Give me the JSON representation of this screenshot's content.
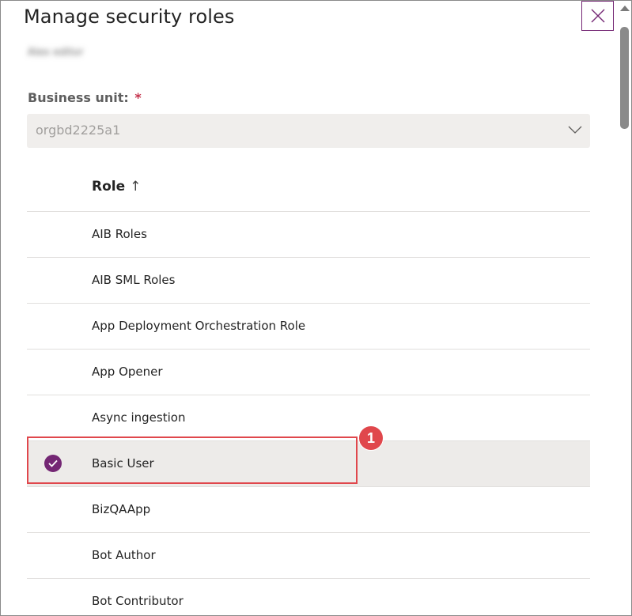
{
  "dialog": {
    "title": "Manage security roles",
    "user_name": "Alex editor"
  },
  "business_unit": {
    "label": "Business unit:",
    "required_mark": "*",
    "value": "orgbd2225a1"
  },
  "grid": {
    "column_header": "Role",
    "sort_indicator": "↑",
    "rows": [
      {
        "label": "AIB Roles",
        "selected": false
      },
      {
        "label": "AIB SML Roles",
        "selected": false
      },
      {
        "label": "App Deployment Orchestration Role",
        "selected": false
      },
      {
        "label": "App Opener",
        "selected": false
      },
      {
        "label": "Async ingestion",
        "selected": false
      },
      {
        "label": "Basic User",
        "selected": true
      },
      {
        "label": "BizQAApp",
        "selected": false
      },
      {
        "label": "Bot Author",
        "selected": false
      },
      {
        "label": "Bot Contributor",
        "selected": false
      }
    ]
  },
  "annotation": {
    "step_number": "1",
    "color": "#e0474c"
  },
  "colors": {
    "accent": "#742774",
    "selected_row_bg": "#edebe9",
    "required": "#c4314b"
  },
  "icons": {
    "close": "close-icon",
    "dropdown": "chevron-down-icon",
    "check": "checkmark-circle-icon",
    "sort": "arrow-up-icon"
  }
}
